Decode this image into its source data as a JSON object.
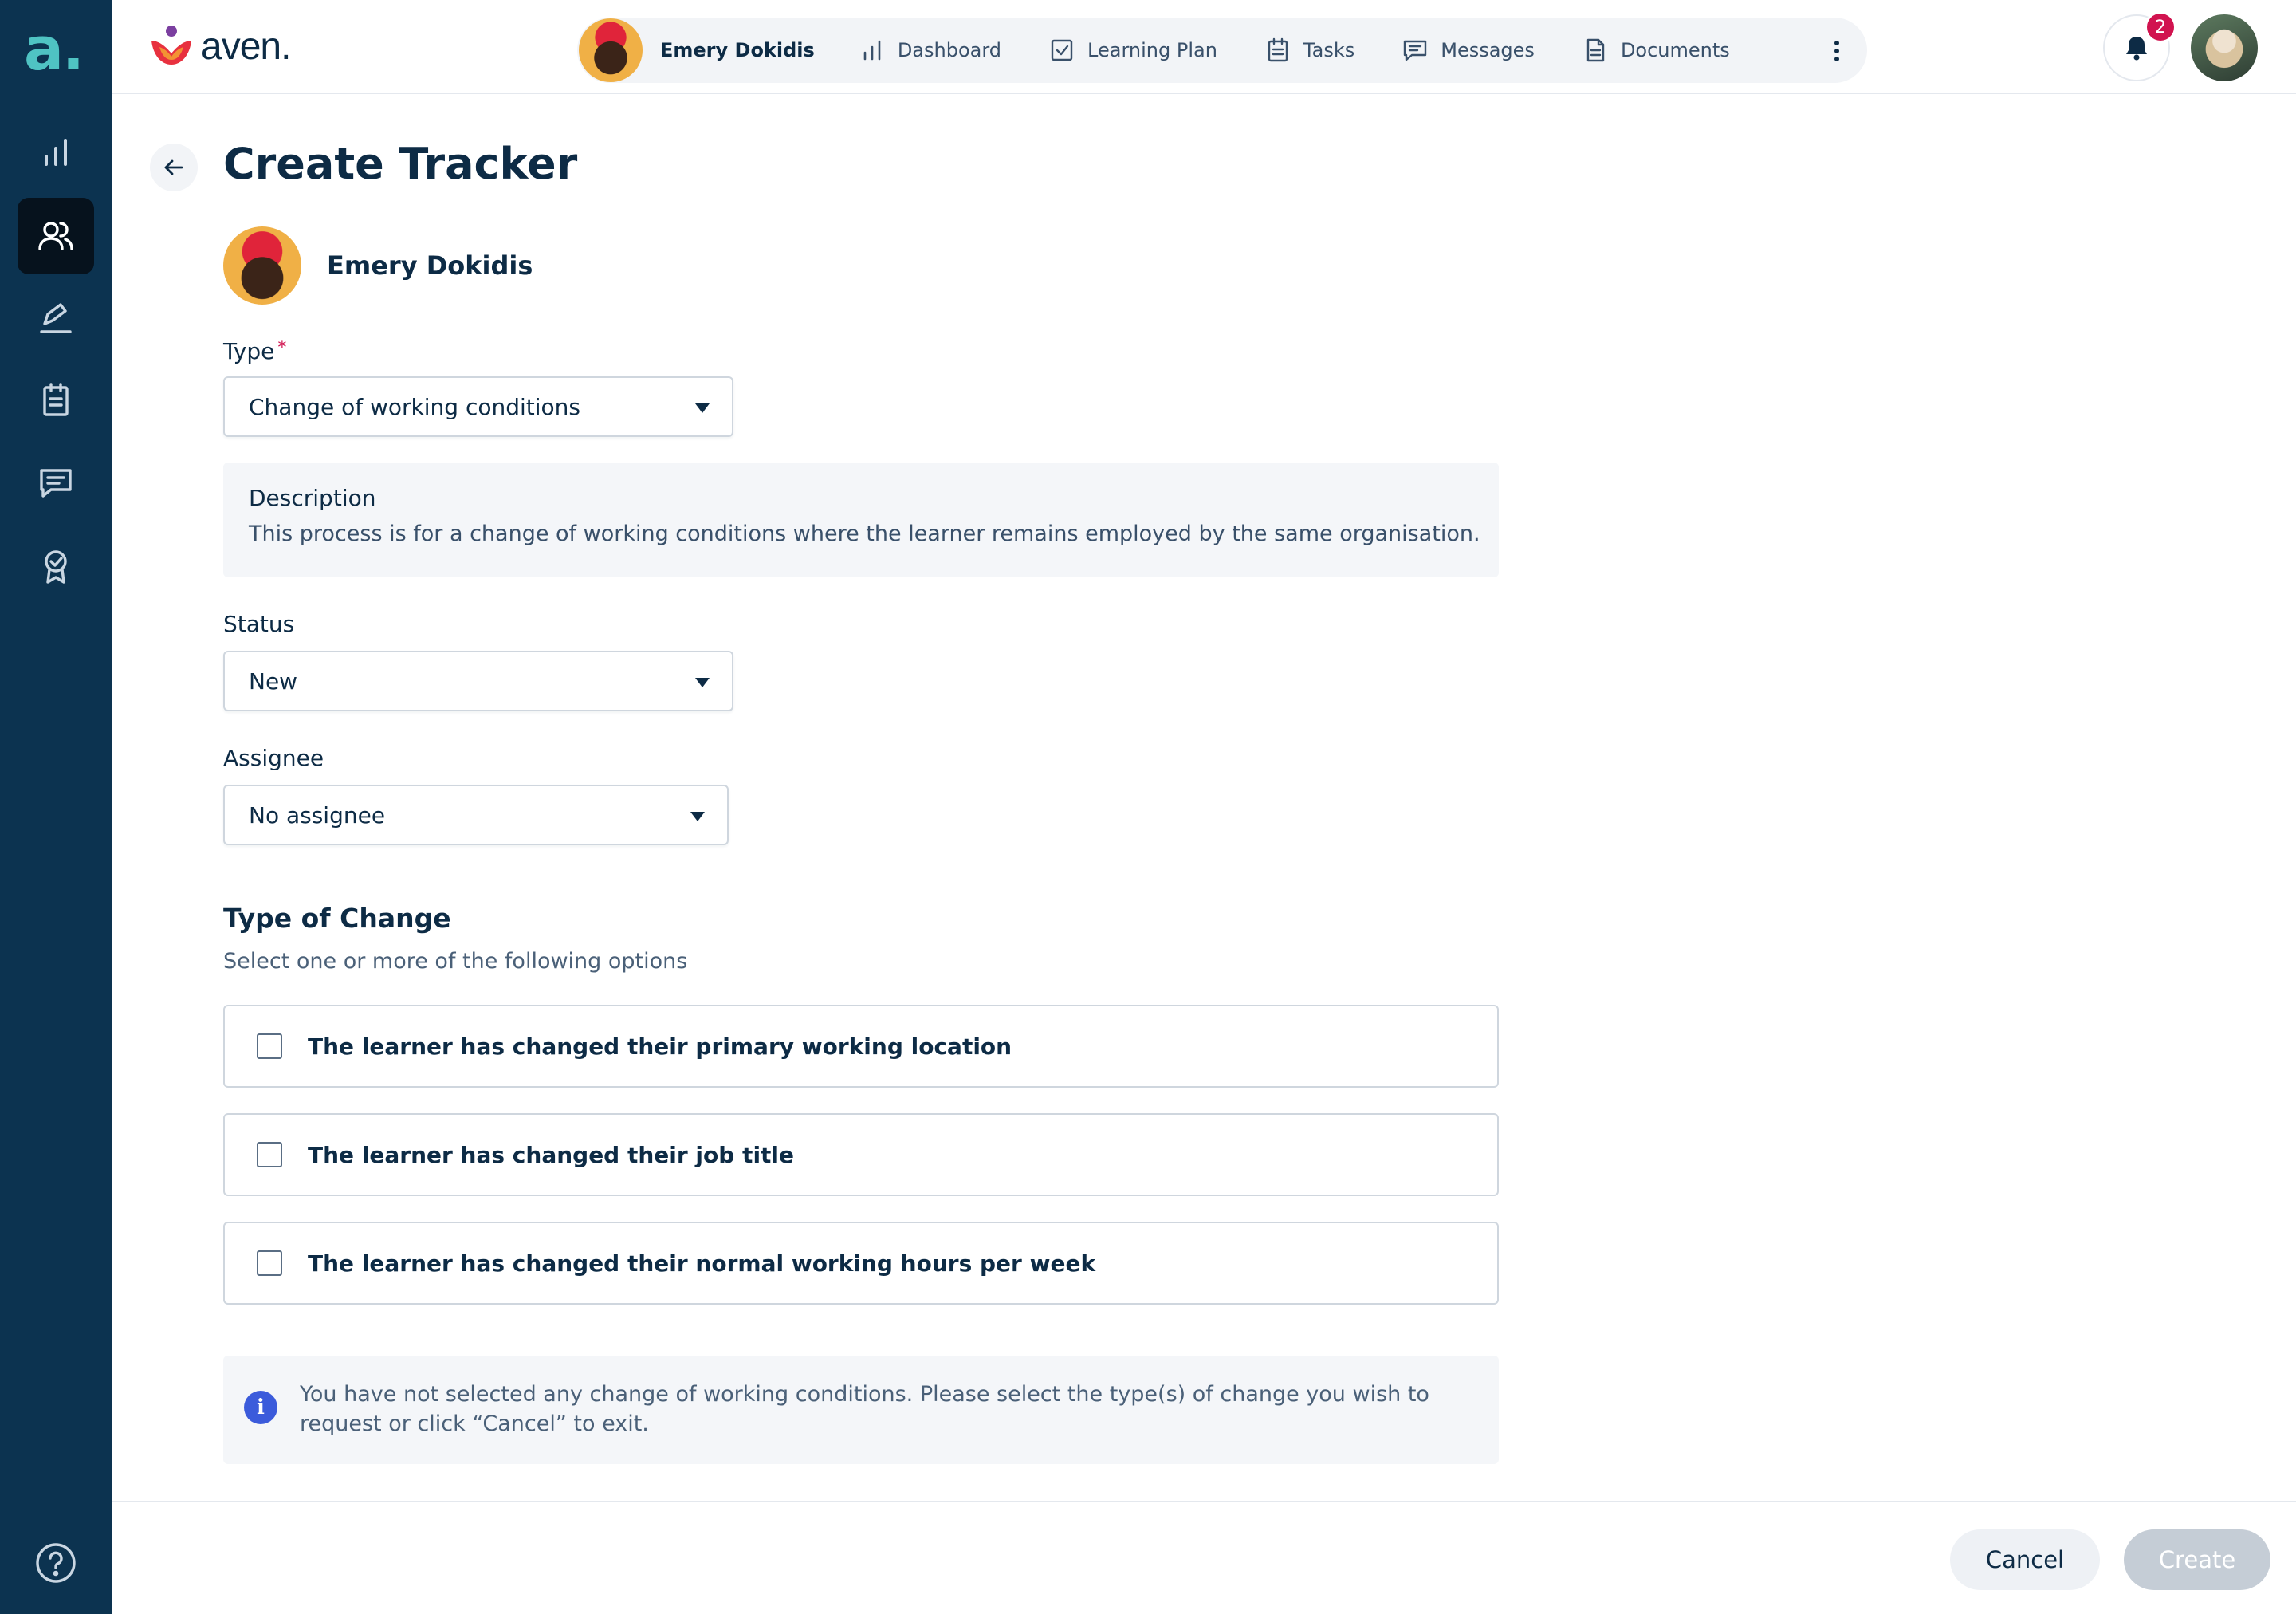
{
  "rail": {
    "logo": "a.",
    "items": [
      "dashboard",
      "people",
      "sign",
      "tasks",
      "messages",
      "badge"
    ],
    "help": "help"
  },
  "topbar": {
    "brand": "aven.",
    "learner": {
      "name": "Emery Dokidis"
    },
    "nav": [
      {
        "label": "Dashboard",
        "icon": "bar-chart-icon"
      },
      {
        "label": "Learning Plan",
        "icon": "checkbox-icon"
      },
      {
        "label": "Tasks",
        "icon": "clipboard-icon"
      },
      {
        "label": "Messages",
        "icon": "message-icon"
      },
      {
        "label": "Documents",
        "icon": "document-icon"
      }
    ],
    "notifications": {
      "count": "2"
    }
  },
  "page": {
    "title": "Create Tracker",
    "learner_name": "Emery Dokidis",
    "type": {
      "label": "Type",
      "required": "*",
      "value": "Change of working conditions"
    },
    "description": {
      "title": "Description",
      "text": "This process is for a change of working conditions where the learner remains employed by the same organisation."
    },
    "status": {
      "label": "Status",
      "value": "New"
    },
    "assignee": {
      "label": "Assignee",
      "value": "No assignee"
    },
    "type_of_change": {
      "title": "Type of Change",
      "subtitle": "Select one or more of the following options",
      "options": [
        {
          "label": "The learner has changed their primary working location",
          "checked": false
        },
        {
          "label": "The learner has changed their job title",
          "checked": false
        },
        {
          "label": "The learner has changed their normal working hours per week",
          "checked": false
        }
      ]
    },
    "info": "You have not selected any change of working conditions. Please select the type(s) of change you wish to request or click “Cancel” to exit."
  },
  "footer": {
    "cancel": "Cancel",
    "create": "Create"
  },
  "colors": {
    "rail": "#0c3350",
    "accent_teal": "#4fc3c3",
    "badge": "#d1134f",
    "info": "#3b5bdb",
    "disabled_button": "#c5cdd6"
  }
}
